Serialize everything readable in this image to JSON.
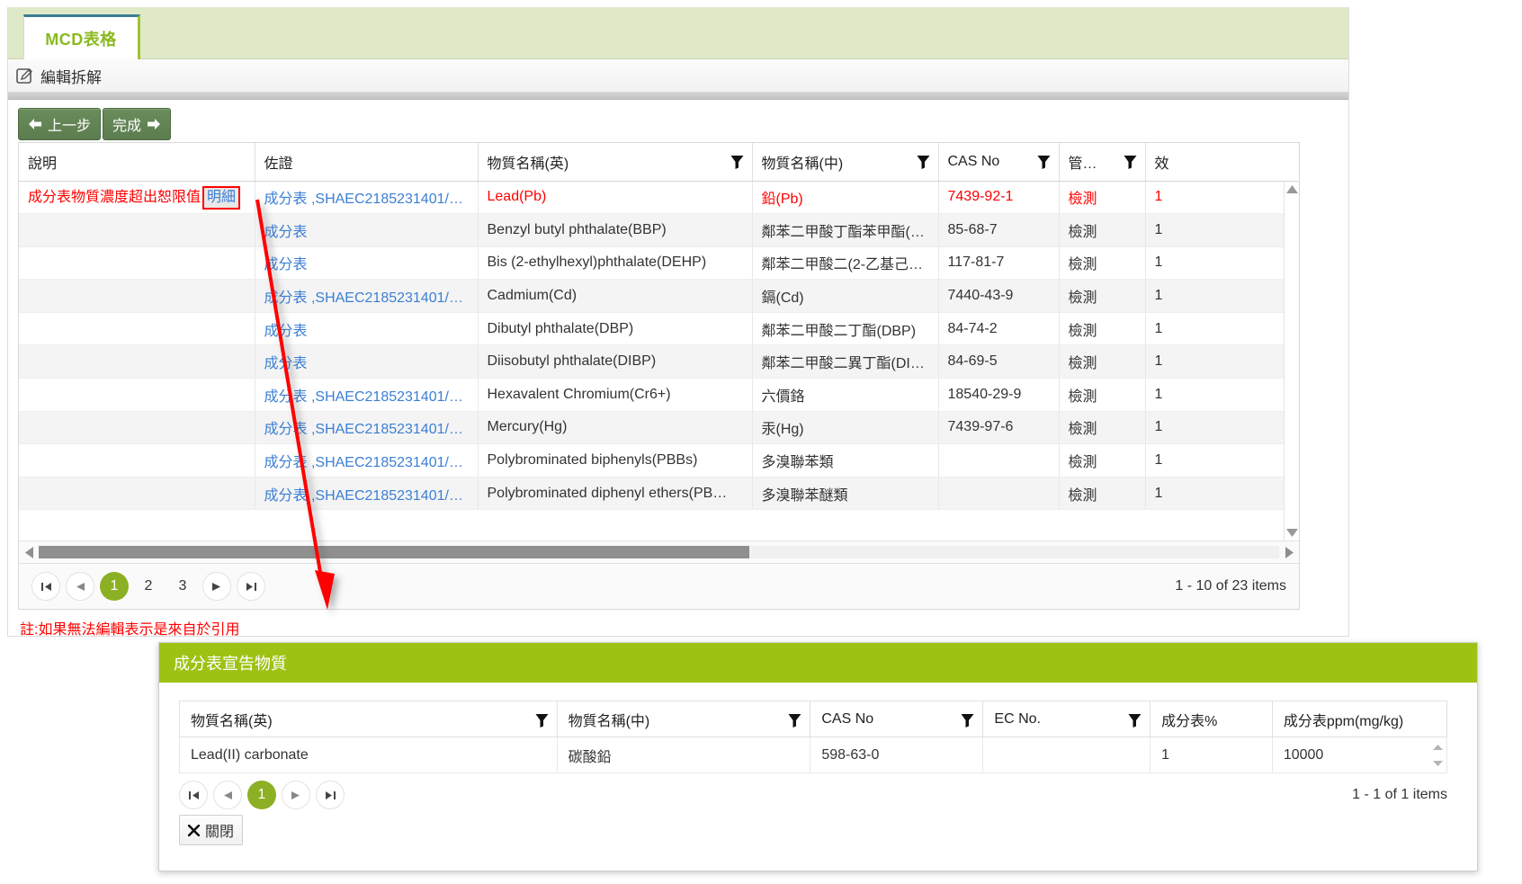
{
  "tab": {
    "label": "MCD表格"
  },
  "subheader": {
    "title": "編輯拆解",
    "icon": "edit-pencil-icon"
  },
  "toolbar": {
    "prev_label": "上一步",
    "done_label": "完成"
  },
  "grid": {
    "columns": [
      {
        "label": "說明",
        "filter": false
      },
      {
        "label": "佐證",
        "filter": false
      },
      {
        "label": "物質名稱(英)",
        "filter": true
      },
      {
        "label": "物質名稱(中)",
        "filter": true
      },
      {
        "label": "CAS No",
        "filter": true
      },
      {
        "label": "管…",
        "filter": true
      },
      {
        "label": "效",
        "filter": false
      }
    ],
    "rows": [
      {
        "alert": true,
        "desc": "成分表物質濃度超出恕限值",
        "desc_link": "明細",
        "evidence": "成分表 ,SHAEC2185231401/…",
        "name_en": "Lead(Pb)",
        "name_zh": "鉛(Pb)",
        "cas": "7439-92-1",
        "control": "檢測",
        "last": "1"
      },
      {
        "alert": false,
        "desc": "",
        "desc_link": "",
        "evidence": "成分表",
        "name_en": "Benzyl butyl phthalate(BBP)",
        "name_zh": "鄰苯二甲酸丁酯苯甲酯(…",
        "cas": "85-68-7",
        "control": "檢測",
        "last": "1"
      },
      {
        "alert": false,
        "desc": "",
        "desc_link": "",
        "evidence": "成分表",
        "name_en": "Bis (2-ethylhexyl)phthalate(DEHP)",
        "name_zh": "鄰苯二甲酸二(2-乙基己…",
        "cas": "117-81-7",
        "control": "檢測",
        "last": "1"
      },
      {
        "alert": false,
        "desc": "",
        "desc_link": "",
        "evidence": "成分表 ,SHAEC2185231401/…",
        "name_en": "Cadmium(Cd)",
        "name_zh": "鎘(Cd)",
        "cas": "7440-43-9",
        "control": "檢測",
        "last": "1"
      },
      {
        "alert": false,
        "desc": "",
        "desc_link": "",
        "evidence": "成分表",
        "name_en": "Dibutyl phthalate(DBP)",
        "name_zh": "鄰苯二甲酸二丁酯(DBP)",
        "cas": "84-74-2",
        "control": "檢測",
        "last": "1"
      },
      {
        "alert": false,
        "desc": "",
        "desc_link": "",
        "evidence": "成分表",
        "name_en": "Diisobutyl phthalate(DIBP)",
        "name_zh": "鄰苯二甲酸二異丁酯(DI…",
        "cas": "84-69-5",
        "control": "檢測",
        "last": "1"
      },
      {
        "alert": false,
        "desc": "",
        "desc_link": "",
        "evidence": "成分表 ,SHAEC2185231401/…",
        "name_en": "Hexavalent Chromium(Cr6+)",
        "name_zh": "六價鉻",
        "cas": "18540-29-9",
        "control": "檢測",
        "last": "1"
      },
      {
        "alert": false,
        "desc": "",
        "desc_link": "",
        "evidence": "成分表 ,SHAEC2185231401/…",
        "name_en": "Mercury(Hg)",
        "name_zh": "汞(Hg)",
        "cas": "7439-97-6",
        "control": "檢測",
        "last": "1"
      },
      {
        "alert": false,
        "desc": "",
        "desc_link": "",
        "evidence": "成分表 ,SHAEC2185231401/…",
        "name_en": "Polybrominated biphenyls(PBBs)",
        "name_zh": "多溴聯苯類",
        "cas": "",
        "control": "檢測",
        "last": "1"
      },
      {
        "alert": false,
        "desc": "",
        "desc_link": "",
        "evidence": "成分表 ,SHAEC2185231401/…",
        "name_en": "Polybrominated diphenyl ethers(PB…",
        "name_zh": "多溴聯苯醚類",
        "cas": "",
        "control": "檢測",
        "last": "1"
      }
    ],
    "pager": {
      "pages": [
        "1",
        "2",
        "3"
      ],
      "current": "1",
      "info": "1 - 10 of 23 items"
    }
  },
  "footnote": "註:如果無法編輯表示是來自於引用",
  "modal": {
    "title": "成分表宣告物質",
    "columns": [
      {
        "label": "物質名稱(英)",
        "filter": true
      },
      {
        "label": "物質名稱(中)",
        "filter": true
      },
      {
        "label": "CAS No",
        "filter": true
      },
      {
        "label": "EC No.",
        "filter": true
      },
      {
        "label": "成分表%",
        "filter": false
      },
      {
        "label": "成分表ppm(mg/kg)",
        "filter": false
      }
    ],
    "rows": [
      {
        "name_en": "Lead(II) carbonate",
        "name_zh": "碳酸鉛",
        "cas": "598-63-0",
        "ec": "",
        "pct": "1",
        "ppm": "10000"
      }
    ],
    "pager": {
      "pages": [
        "1"
      ],
      "current": "1",
      "info": "1 - 1 of 1 items"
    },
    "close_label": "關閉"
  },
  "colors": {
    "tab_text": "#8aba1f",
    "tab_strip_bg": "#dfe9c8",
    "modal_header_bg": "#9ec214",
    "pager_active_bg": "#8cb023",
    "button_bg": "#5c7d4f",
    "alert_text": "#ff0000",
    "link_text": "#3b7fd4",
    "annotation_arrow": "#ff0000"
  }
}
